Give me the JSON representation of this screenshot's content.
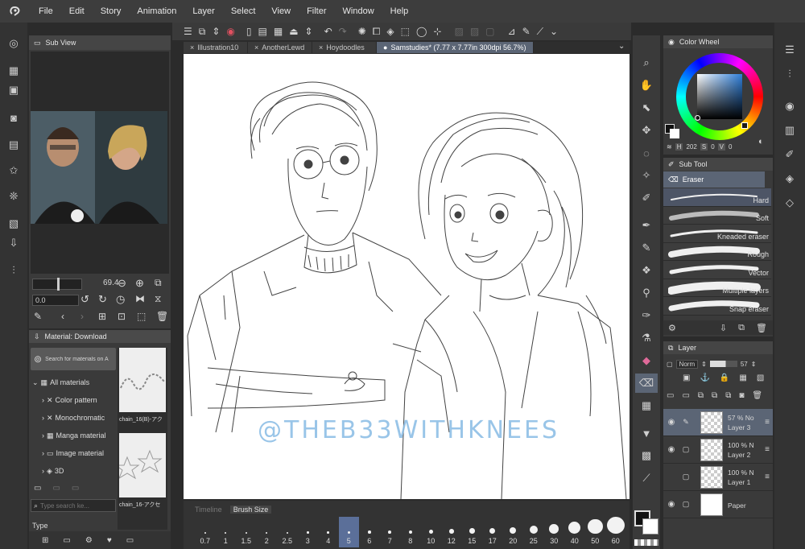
{
  "menu": [
    "File",
    "Edit",
    "Story",
    "Animation",
    "Layer",
    "Select",
    "View",
    "Filter",
    "Window",
    "Help"
  ],
  "tabs": [
    {
      "label": "Illustration10",
      "active": false
    },
    {
      "label": "AnotherLewd",
      "active": false
    },
    {
      "label": "Hoydoodles",
      "active": false
    },
    {
      "label": "Samstudies* (7.77 x 7.77in 300dpi 56.7%)",
      "active": true
    }
  ],
  "sub_view": {
    "title": "Sub View",
    "zoom": "69.4",
    "angle": "0.0"
  },
  "material": {
    "title": "Material: Download",
    "search_label": "Search for materials on A",
    "tree": [
      {
        "label": "All materials",
        "expanded": true
      },
      {
        "label": "Color pattern"
      },
      {
        "label": "Monochromatic"
      },
      {
        "label": "Manga material"
      },
      {
        "label": "Image material"
      },
      {
        "label": "3D"
      }
    ],
    "thumbs": [
      "chain_16(B)-アク",
      "chain_16-アクセ"
    ],
    "keyword_placeholder": "Type search ke...",
    "type_label": "Type"
  },
  "color_wheel": {
    "title": "Color Wheel",
    "h": "202",
    "s": "0",
    "v": "0",
    "h_label": "H",
    "s_label": "S",
    "v_label": "V"
  },
  "sub_tool": {
    "title": "Sub Tool",
    "group": "Eraser",
    "items": [
      {
        "label": "Hard",
        "selected": true
      },
      {
        "label": "Soft"
      },
      {
        "label": "Kneaded eraser"
      },
      {
        "label": "Rough"
      },
      {
        "label": "Vector"
      },
      {
        "label": "Multiple layers"
      },
      {
        "label": "Snap eraser"
      }
    ]
  },
  "layer": {
    "title": "Layer",
    "blend": "Norm",
    "opacity": "57",
    "items": [
      {
        "pct": "57 % No",
        "name": "Layer 3",
        "selected": true
      },
      {
        "pct": "100 % N",
        "name": "Layer 2",
        "selected": false
      },
      {
        "pct": "100 % N",
        "name": "Layer 1",
        "selected": false
      },
      {
        "pct": "",
        "name": "Paper",
        "selected": false
      }
    ]
  },
  "timeline": {
    "tab_timeline": "Timeline",
    "tab_brush": "Brush Size"
  },
  "brush_sizes": [
    "0.7",
    "1",
    "1.5",
    "2",
    "2.5",
    "3",
    "4",
    "5",
    "6",
    "7",
    "8",
    "10",
    "12",
    "15",
    "17",
    "20",
    "25",
    "30",
    "40",
    "50",
    "60"
  ],
  "brush_selected": "5",
  "watermark": "@THEB33WITHKNEES",
  "colors": {
    "accent": "#5b6575",
    "bg": "#2b2b2b",
    "panel": "#3a3a3a",
    "watermark": "#8fbfe6"
  }
}
